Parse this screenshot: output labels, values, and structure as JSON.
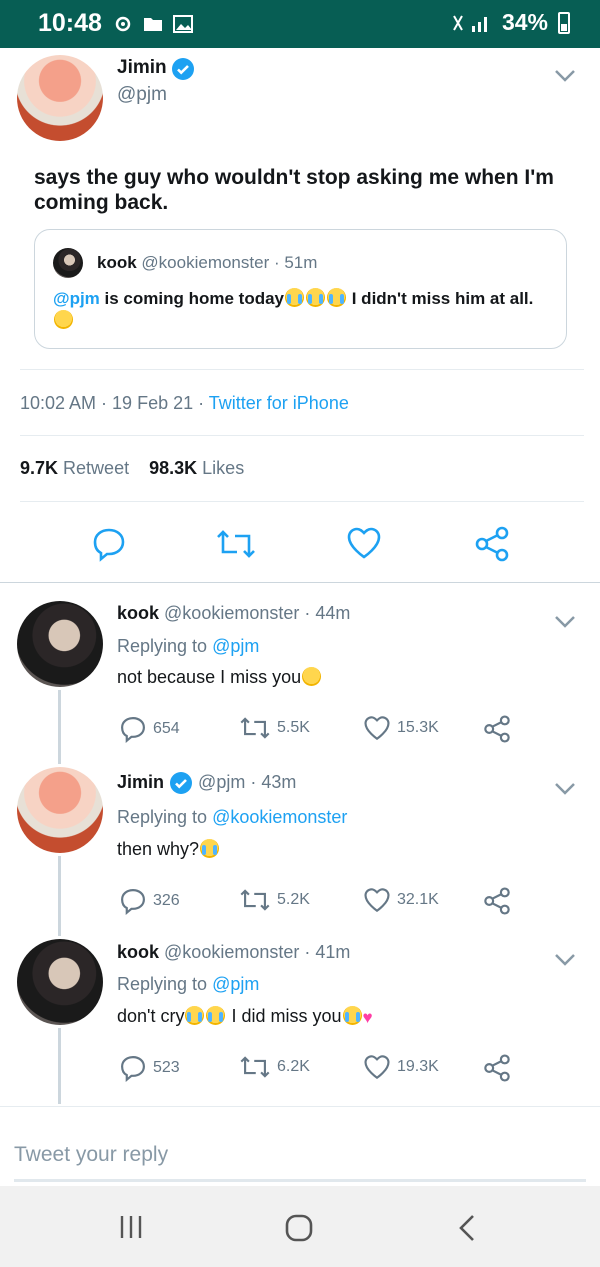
{
  "status_bar": {
    "time": "10:48",
    "battery": "34%",
    "background": "#075e54"
  },
  "main_tweet": {
    "author_name": "Jimin",
    "author_handle": "@pjm",
    "text": "says the guy who wouldn't stop asking me when I'm coming back.",
    "quote": {
      "author_name": "kook",
      "author_handle": "@kookiemonster",
      "time": "· 51m",
      "mention": "@pjm",
      "text_part1": " is coming home today",
      "text_part2": " I didn't miss him at all."
    },
    "timestamp": "10:02 AM · 19 Feb 21 · ",
    "client": "Twitter for iPhone",
    "retweets_count": "9.7K",
    "retweets_label": "Retweet",
    "likes_count": "98.3K",
    "likes_label": "Likes"
  },
  "replies": [
    {
      "author_name": "kook",
      "author_handle": "@kookiemonster",
      "time": "· 44m",
      "replying_label": "Replying to ",
      "replying_to": "@pjm",
      "text": "not because I miss you",
      "reply_count": "654",
      "retweet_count": "5.5K",
      "like_count": "15.3K"
    },
    {
      "author_name": "Jimin",
      "author_handle": "@pjm",
      "time": "· 43m",
      "replying_label": "Replying to ",
      "replying_to": "@kookiemonster",
      "text": "then why?",
      "reply_count": "326",
      "retweet_count": "5.2K",
      "like_count": "32.1K"
    },
    {
      "author_name": "kook",
      "author_handle": "@kookiemonster",
      "time": "· 41m",
      "replying_label": "Replying to ",
      "replying_to": "@pjm",
      "text_part1": "don't cry",
      "text_part2": " I did miss you",
      "reply_count": "523",
      "retweet_count": "6.2K",
      "like_count": "19.3K"
    }
  ],
  "composer": {
    "placeholder": "Tweet your reply"
  },
  "colors": {
    "accent": "#1da1f2",
    "secondary_text": "#657786",
    "primary_text": "#14171a"
  },
  "icons": [
    "verified-badge-icon",
    "chevron-down-icon",
    "reply-icon",
    "retweet-icon",
    "like-icon",
    "share-icon",
    "recents-icon",
    "home-icon",
    "back-icon"
  ]
}
